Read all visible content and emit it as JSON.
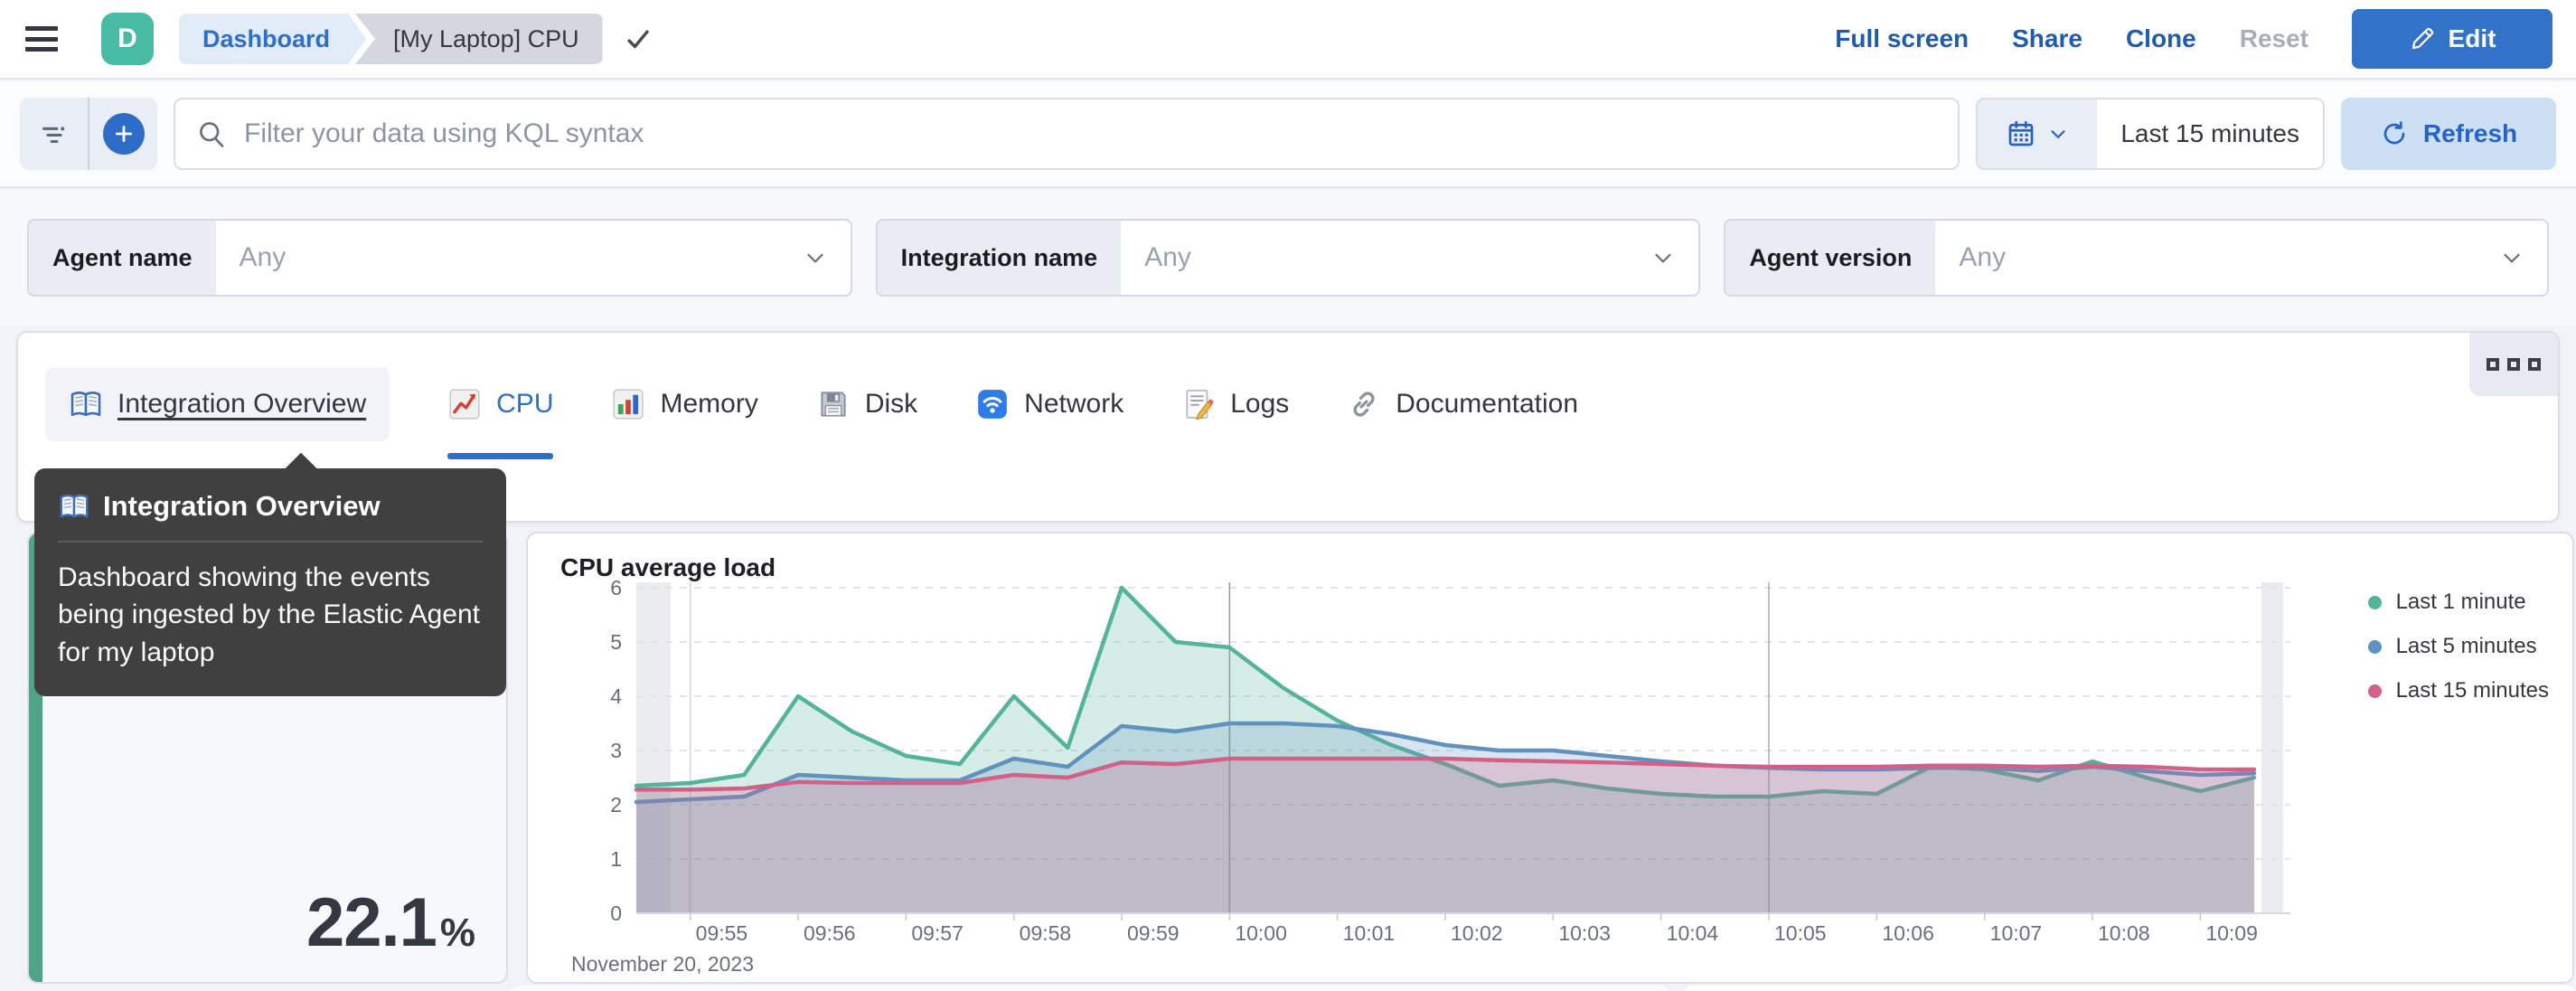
{
  "header": {
    "logo_letter": "D",
    "breadcrumbs": {
      "first": "Dashboard",
      "second": "[My Laptop] CPU"
    },
    "actions": {
      "full_screen": "Full screen",
      "share": "Share",
      "clone": "Clone",
      "reset": "Reset"
    },
    "edit_label": "Edit"
  },
  "query_bar": {
    "search_placeholder": "Filter your data using KQL syntax",
    "time_range": "Last 15 minutes",
    "refresh_label": "Refresh"
  },
  "filters": [
    {
      "label": "Agent name",
      "value": "Any"
    },
    {
      "label": "Integration name",
      "value": "Any"
    },
    {
      "label": "Agent version",
      "value": "Any"
    }
  ],
  "tabs": [
    {
      "label": "Integration Overview",
      "icon": "book-icon"
    },
    {
      "label": "CPU",
      "icon": "chart-increasing-icon"
    },
    {
      "label": "Memory",
      "icon": "bar-chart-icon"
    },
    {
      "label": "Disk",
      "icon": "floppy-disk-icon"
    },
    {
      "label": "Network",
      "icon": "wireless-icon"
    },
    {
      "label": "Logs",
      "icon": "memo-icon"
    },
    {
      "label": "Documentation",
      "icon": "link-icon"
    }
  ],
  "tooltip": {
    "title": "Integration Overview",
    "body": "Dashboard showing the events being ingested by the Elastic Agent for my laptop"
  },
  "metric_panel": {
    "value": "22.1",
    "unit": "%",
    "accent_color": "#4FA387"
  },
  "chart_data": {
    "type": "area",
    "title": "CPU average load",
    "x_start": "09:54:30",
    "x_interval_seconds": 30,
    "x_tick_labels": [
      "09:55",
      "09:56",
      "09:57",
      "09:58",
      "09:59",
      "10:00",
      "10:01",
      "10:02",
      "10:03",
      "10:04",
      "10:05",
      "10:06",
      "10:07",
      "10:08",
      "10:09"
    ],
    "x_context_label": "November 20, 2023",
    "ylim": [
      0,
      6
    ],
    "y_ticks": [
      0,
      1,
      2,
      3,
      4,
      5,
      6
    ],
    "grid": true,
    "legend_position": "right",
    "series": [
      {
        "name": "Last 1 minute",
        "color": "#54B399",
        "values": [
          2.35,
          2.4,
          2.55,
          4.0,
          3.35,
          2.9,
          2.75,
          4.0,
          3.05,
          6.0,
          5.0,
          4.9,
          4.15,
          3.55,
          3.1,
          2.75,
          2.35,
          2.45,
          2.3,
          2.2,
          2.15,
          2.15,
          2.25,
          2.2,
          2.7,
          2.65,
          2.45,
          2.8,
          2.5,
          2.25,
          2.5
        ]
      },
      {
        "name": "Last 5 minutes",
        "color": "#6092C0",
        "values": [
          2.05,
          2.1,
          2.15,
          2.55,
          2.5,
          2.45,
          2.45,
          2.85,
          2.7,
          3.45,
          3.35,
          3.5,
          3.5,
          3.45,
          3.3,
          3.1,
          3.0,
          3.0,
          2.9,
          2.8,
          2.72,
          2.68,
          2.65,
          2.65,
          2.68,
          2.68,
          2.62,
          2.7,
          2.62,
          2.55,
          2.58
        ]
      },
      {
        "name": "Last 15 minutes",
        "color": "#D36086",
        "values": [
          2.28,
          2.28,
          2.3,
          2.42,
          2.4,
          2.4,
          2.4,
          2.55,
          2.5,
          2.78,
          2.75,
          2.85,
          2.85,
          2.85,
          2.85,
          2.85,
          2.82,
          2.8,
          2.78,
          2.75,
          2.72,
          2.7,
          2.7,
          2.7,
          2.72,
          2.72,
          2.7,
          2.72,
          2.7,
          2.65,
          2.65
        ]
      }
    ]
  }
}
